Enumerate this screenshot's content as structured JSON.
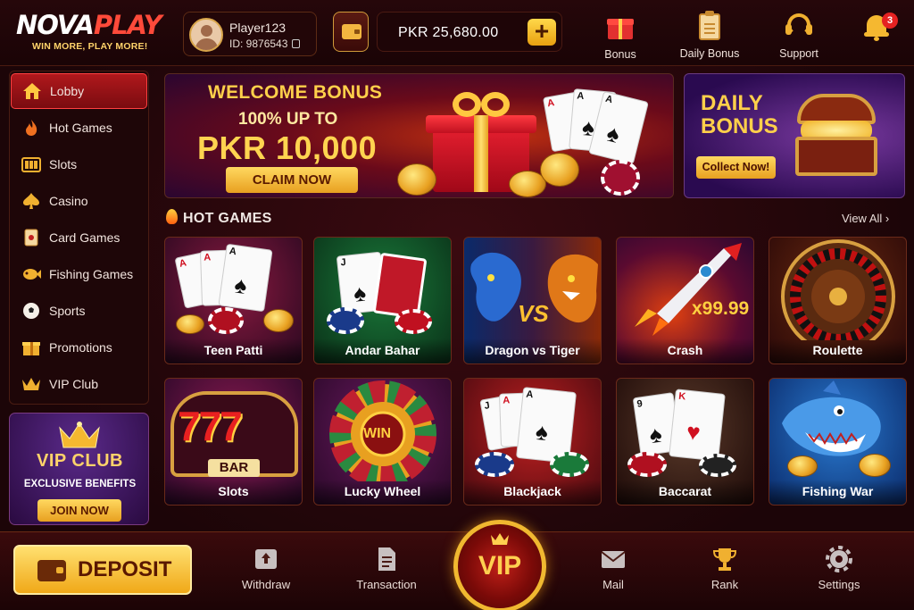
{
  "brand": {
    "name_a": "NOVA",
    "name_b": "PLAY",
    "tagline": "WIN MORE, PLAY MORE!"
  },
  "player": {
    "name": "Player123",
    "id": "ID: 9876543"
  },
  "wallet": {
    "balance": "PKR 25,680.00",
    "add_label": "+"
  },
  "top_actions": [
    {
      "label": "Bonus",
      "icon": "gift-icon"
    },
    {
      "label": "Daily Bonus",
      "icon": "clipboard-icon"
    },
    {
      "label": "Support",
      "icon": "headset-icon"
    }
  ],
  "notifications": {
    "count": "3",
    "icon": "bell-icon"
  },
  "sidebar": {
    "items": [
      {
        "label": "Lobby",
        "icon": "home-icon",
        "active": true
      },
      {
        "label": "Hot Games",
        "icon": "flame-icon"
      },
      {
        "label": "Slots",
        "icon": "slot-icon"
      },
      {
        "label": "Casino",
        "icon": "spade-icon"
      },
      {
        "label": "Card Games",
        "icon": "card-icon"
      },
      {
        "label": "Fishing Games",
        "icon": "fish-icon"
      },
      {
        "label": "Sports",
        "icon": "ball-icon"
      },
      {
        "label": "Promotions",
        "icon": "gift-icon"
      },
      {
        "label": "VIP Club",
        "icon": "crown-icon"
      }
    ]
  },
  "vip_card": {
    "title": "VIP CLUB",
    "subtitle": "EXCLUSIVE BENEFITS",
    "button": "JOIN NOW"
  },
  "welcome_banner": {
    "line1": "WELCOME BONUS",
    "line2": "100% UP TO",
    "line3": "PKR 10,000",
    "button": "CLAIM NOW"
  },
  "daily_banner": {
    "title_line1": "DAILY",
    "title_line2": "BONUS",
    "button": "Collect Now!"
  },
  "hot_games": {
    "title": "HOT GAMES",
    "view_all": "View All ›",
    "games": [
      "Teen Patti",
      "Andar Bahar",
      "Dragon vs Tiger",
      "Crash",
      "Roulette",
      "Slots",
      "Lucky Wheel",
      "Blackjack",
      "Baccarat",
      "Fishing War"
    ]
  },
  "game_art_text": {
    "vs": "VS",
    "crash_mult": "x99.99",
    "bar": "BAR",
    "sevens": "777",
    "win": "WIN",
    "cards": [
      "A",
      "A",
      "A",
      "J",
      "9",
      "K",
      "A"
    ]
  },
  "bottom_nav": {
    "deposit": "DEPOSIT",
    "vip": "VIP",
    "items": [
      {
        "label": "Withdraw",
        "icon": "withdraw-icon"
      },
      {
        "label": "Transaction",
        "icon": "document-icon"
      },
      {
        "label": "Mail",
        "icon": "mail-icon"
      },
      {
        "label": "Rank",
        "icon": "trophy-icon"
      },
      {
        "label": "Settings",
        "icon": "gear-icon"
      }
    ]
  },
  "colors": {
    "accent": "#ffd04a",
    "active": "#b0181c",
    "bg": "#1c0508"
  }
}
